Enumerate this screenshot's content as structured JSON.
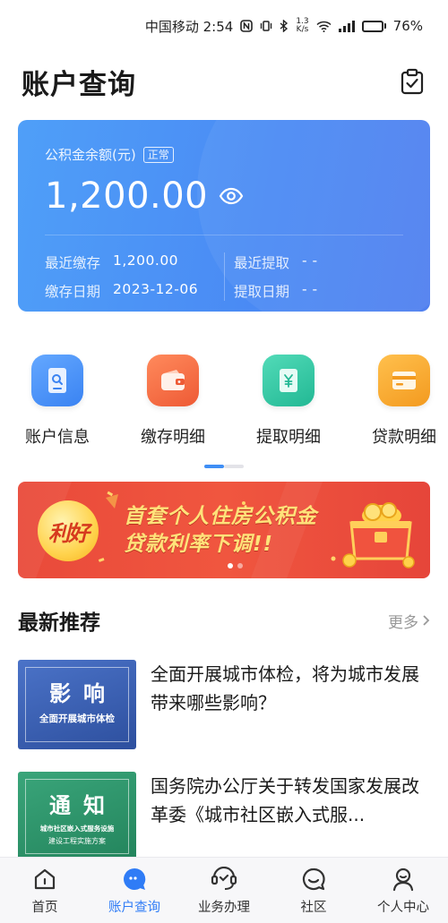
{
  "status_bar": {
    "carrier_time": "中国移动 2:54",
    "net_speed_value": "1.3",
    "net_speed_unit": "K/s",
    "battery_percent": 76,
    "battery_text": "76%"
  },
  "header": {
    "title": "账户查询",
    "right_icon": "clipboard-check-icon"
  },
  "balance_card": {
    "label": "公积金余额(元)",
    "status_tag": "正常",
    "amount": "1,200.00",
    "eye_icon": "eye-icon",
    "recent_deposit_label": "最近缴存",
    "recent_deposit_value": "1,200.00",
    "deposit_date_label": "缴存日期",
    "deposit_date_value": "2023-12-06",
    "recent_withdraw_label": "最近提取",
    "recent_withdraw_value": "- -",
    "withdraw_date_label": "提取日期",
    "withdraw_date_value": "- -"
  },
  "quick_menu": [
    {
      "label": "账户信息",
      "icon": "account-search-icon",
      "color": "#3f8ef5"
    },
    {
      "label": "缴存明细",
      "icon": "wallet-icon",
      "color": "#f0683f"
    },
    {
      "label": "提取明细",
      "icon": "yuan-note-icon",
      "color": "#2cc7a3"
    },
    {
      "label": "贷款明细",
      "icon": "card-icon",
      "color": "#f4a531"
    }
  ],
  "banner": {
    "badge": "利好",
    "line1": "首套个人住房公积金",
    "line2": "贷款利率下调!!"
  },
  "recommend": {
    "title": "最新推荐",
    "more": "更多",
    "items": [
      {
        "thumb_big": "影响",
        "thumb_small": "全面开展城市体检",
        "thumb_small2": "",
        "title": "全面开展城市体检，将为城市发展带来哪些影响？",
        "color": "#3e63b4"
      },
      {
        "thumb_big": "通知",
        "thumb_small": "城市社区嵌入式服务设施",
        "thumb_small2": "建设工程实施方案",
        "title": "国务院办公厅关于转发国家发展改革委《城市社区嵌入式服...",
        "color": "#2f9a6f"
      }
    ]
  },
  "tabbar": {
    "items": [
      {
        "label": "首页",
        "icon": "home-icon"
      },
      {
        "label": "账户查询",
        "icon": "chat-bubble-icon",
        "active": true
      },
      {
        "label": "业务办理",
        "icon": "service-icon"
      },
      {
        "label": "社区",
        "icon": "community-icon"
      },
      {
        "label": "个人中心",
        "icon": "profile-icon"
      }
    ],
    "active_color": "#2f7cf6"
  }
}
